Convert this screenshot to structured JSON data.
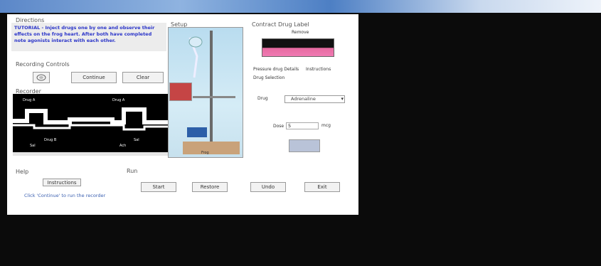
{
  "window": {
    "title": ""
  },
  "instructions": {
    "group_label": "Directions",
    "text": "TUTORIAL - Inject drugs one by one and observe their effects on the frog heart. After both have completed note agonists interact with each other."
  },
  "recording_controls": {
    "group_label": "Recording Controls",
    "buttons": [
      "",
      "Continue",
      "Clear"
    ]
  },
  "recording": {
    "group_label": "Recorder",
    "markers": [
      "Drug A",
      "Drug A",
      "Sal",
      "Drug B",
      "Ach",
      "Sal",
      "Ach Ses"
    ]
  },
  "setup": {
    "group_label": "Setup",
    "caption": "Frog"
  },
  "drugs": {
    "group_label": "Contract  Drug  Label",
    "tab_top": "Remove",
    "tabs": [
      "Pressure drug Details",
      "Instructions"
    ],
    "selection_label": "Drug Selection",
    "drug_label": "Drug",
    "drug_value": "Adrenaline",
    "dose_label": "Dose",
    "dose_value": "5",
    "dose_unit": "mcg"
  },
  "help": {
    "group_label": "Help",
    "button": "Instructions",
    "hint": "Click 'Continue' to run the recorder"
  },
  "run": {
    "group_label": "Run",
    "buttons": [
      "Start",
      "Restore",
      "Undo",
      "Exit"
    ]
  }
}
